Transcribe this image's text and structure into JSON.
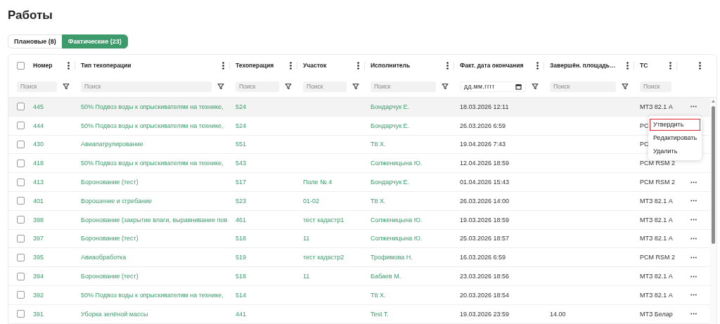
{
  "page_title": "Работы",
  "tabs": [
    {
      "label": "Плановые (8)",
      "selected": false
    },
    {
      "label": "Фактические (23)",
      "selected": true
    }
  ],
  "table": {
    "select_all_checked": false,
    "columns": [
      {
        "label": "Номер",
        "kind": "text",
        "placeholder": "Поиск"
      },
      {
        "label": "Тип техоперации",
        "kind": "text",
        "placeholder": "Поиск"
      },
      {
        "label": "Техоперация",
        "kind": "text",
        "placeholder": "Поиск"
      },
      {
        "label": "Участок",
        "kind": "text",
        "placeholder": "Поиск"
      },
      {
        "label": "Исполнитель",
        "kind": "text",
        "placeholder": "Поиск"
      },
      {
        "label": "Факт. дата окончания",
        "kind": "date",
        "placeholder": "дд.мм.гггг"
      },
      {
        "label": "Завершён. площадь…",
        "kind": "text",
        "placeholder": "Поиск"
      },
      {
        "label": "ТС",
        "kind": "plain",
        "placeholder": "Поиск"
      }
    ],
    "rows": [
      {
        "number": "445",
        "type": "50% Подвоз воды к опрыскивателям на технике,",
        "operation": "524",
        "executor": "Бондарчук Е.",
        "end_date": "18.03.2026 12:11",
        "vehicle": "МТЗ 82.1 А",
        "checked": false,
        "hovered": true,
        "more_button": true
      },
      {
        "number": "444",
        "type": "50% Подвоз воды к опрыскивателям на технике,",
        "operation": "524",
        "executor": "Бондарчук Е.",
        "end_date": "26.03.2026 6:59",
        "vehicle": "PC",
        "checked": false,
        "hovered": false,
        "more_button": false
      },
      {
        "number": "430",
        "type": "Авиапатрулирование",
        "operation": "551",
        "executor": "Ttt X.",
        "end_date": "19.04.2026 7:43",
        "vehicle": "PC",
        "checked": false,
        "hovered": false,
        "more_button": false
      },
      {
        "number": "418",
        "type": "50% Подвоз воды к опрыскивателям на технике,",
        "operation": "543",
        "executor": "Солженицына Ю.",
        "end_date": "12.04.2026 18:59",
        "vehicle": "PCM RSM 2",
        "checked": false,
        "hovered": false,
        "more_button": false
      },
      {
        "number": "413",
        "type": "Боронование (тест)",
        "operation": "517",
        "plot": "Поле № 4",
        "executor": "Бондарчук Е.",
        "end_date": "01.04.2026 15:43",
        "vehicle": "PCM RSM 2",
        "checked": false,
        "hovered": false,
        "more_button": true
      },
      {
        "number": "401",
        "type": "Ворошение и сгребание",
        "operation": "523",
        "plot": "01-02",
        "executor": "Ttt X.",
        "end_date": "26.03.2026 14:00",
        "vehicle": "МТЗ 82.1 А",
        "checked": false,
        "hovered": false,
        "more_button": true
      },
      {
        "number": "398",
        "type": "Боронование (закрытие влаги, выравнивание пов",
        "operation": "461",
        "plot": "тест кадастр1",
        "executor": "Солженицына Ю.",
        "end_date": "19.03.2026 18:59",
        "vehicle": "МТЗ 82.1 А",
        "checked": false,
        "hovered": false,
        "more_button": true
      },
      {
        "number": "397",
        "type": "Боронование (тест)",
        "operation": "518",
        "plot": "11",
        "executor": "Солженицына Ю.",
        "end_date": "25.03.2026 18:57",
        "vehicle": "МТЗ 82.1 А",
        "checked": false,
        "hovered": false,
        "more_button": true
      },
      {
        "number": "395",
        "type": "Авиаобработка",
        "operation": "519",
        "plot": "тест кадастр2",
        "executor": "Трофимова Н.",
        "end_date": "16.03.2026 6:59",
        "vehicle": "PCM RSM 2",
        "checked": false,
        "hovered": false,
        "more_button": true
      },
      {
        "number": "394",
        "type": "Боронование (тест)",
        "operation": "518",
        "plot": "11",
        "executor": "Бабаев М.",
        "end_date": "23.03.2026 18:56",
        "vehicle": "МТЗ 82.1 А",
        "checked": false,
        "hovered": false,
        "more_button": true
      },
      {
        "number": "392",
        "type": "50% Подвоз воды к опрыскивателям на технике,",
        "operation": "514",
        "executor": "Ttt X.",
        "end_date": "20.03.2026 18:54",
        "vehicle": "МТЗ 82.1 А",
        "checked": false,
        "hovered": false,
        "more_button": true
      },
      {
        "number": "391",
        "type": "Уборка зелёной массы",
        "operation": "441",
        "executor": "Test T.",
        "end_date": "19.03.2026 23:59",
        "area": "14.00",
        "vehicle": "МТЗ Белар",
        "checked": false,
        "hovered": false,
        "more_button": true
      }
    ]
  },
  "context_menu": {
    "items": [
      {
        "label": "Утвердить",
        "highlighted": true
      },
      {
        "label": "Редактировать",
        "highlighted": false
      },
      {
        "label": "Удалить",
        "highlighted": false
      }
    ]
  }
}
